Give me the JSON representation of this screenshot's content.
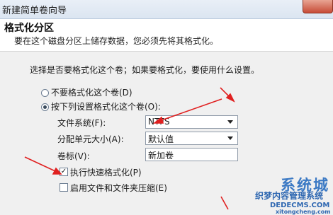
{
  "window": {
    "title": "新建简单卷向导"
  },
  "header": {
    "title": "格式化分区",
    "subtitle": "要在这个磁盘分区上储存数据，您必须先将其格式化。"
  },
  "instruction": "选择是否要格式化这个卷；如果要格式化，要使用什么设置。",
  "options": {
    "no_format": "不要格式化这个卷(D)",
    "format_with": "按下列设置格式化这个卷(O):",
    "selected": "format_with"
  },
  "fields": {
    "filesystem": {
      "label": "文件系统(F):",
      "value": "NTFS"
    },
    "allocation": {
      "label": "分配单元大小(A):",
      "value": "默认值"
    },
    "volume_label": {
      "label": "卷标(V):",
      "value": "新加卷"
    }
  },
  "checkboxes": {
    "quick_format": {
      "label": "执行快速格式化(P)",
      "checked": true
    },
    "compression": {
      "label": "启用文件和文件夹压缩(E)",
      "checked": false
    }
  },
  "watermark": {
    "line1": "系统城",
    "line2": "织梦内容管理系统",
    "line3": "DEDECMS.COM",
    "line4": "xitongcheng.com"
  },
  "colors": {
    "arrow": "#e02020",
    "accent": "#3b79c4"
  }
}
